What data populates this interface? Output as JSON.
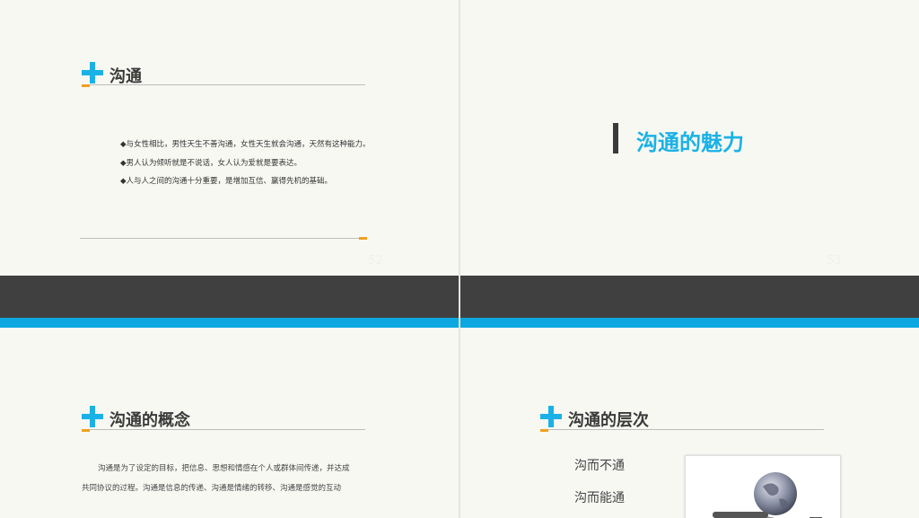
{
  "slide52": {
    "title": "沟通",
    "bullets": [
      "◆与女性相比，男性天生不善沟通，女性天生就会沟通，天然有这种能力。",
      "◆男人认为倾听就是不说话，女人认为爱就是要表达。",
      "◆人与人之间的沟通十分重要，是增加互信、赢得先机的基础。"
    ],
    "page_number": "52"
  },
  "slide53": {
    "title": "沟通的魅力",
    "page_number": "53"
  },
  "slide54": {
    "title": "沟通的概念",
    "paragraph_line1": "沟通是为了设定的目标，把信息、思想和情感在个人或群体间传递，并达成",
    "paragraph_line2": "共同协议的过程。沟通是信息的传递、沟通是情绪的转移、沟通是感觉的互动"
  },
  "slide55": {
    "title": "沟通的层次",
    "levels": [
      "沟而不通",
      "沟而能通"
    ]
  },
  "colors": {
    "accent_blue": "#1ab2e6",
    "accent_orange": "#f0a020",
    "band_dark": "#404040",
    "band_blue": "#0ea8e0"
  }
}
